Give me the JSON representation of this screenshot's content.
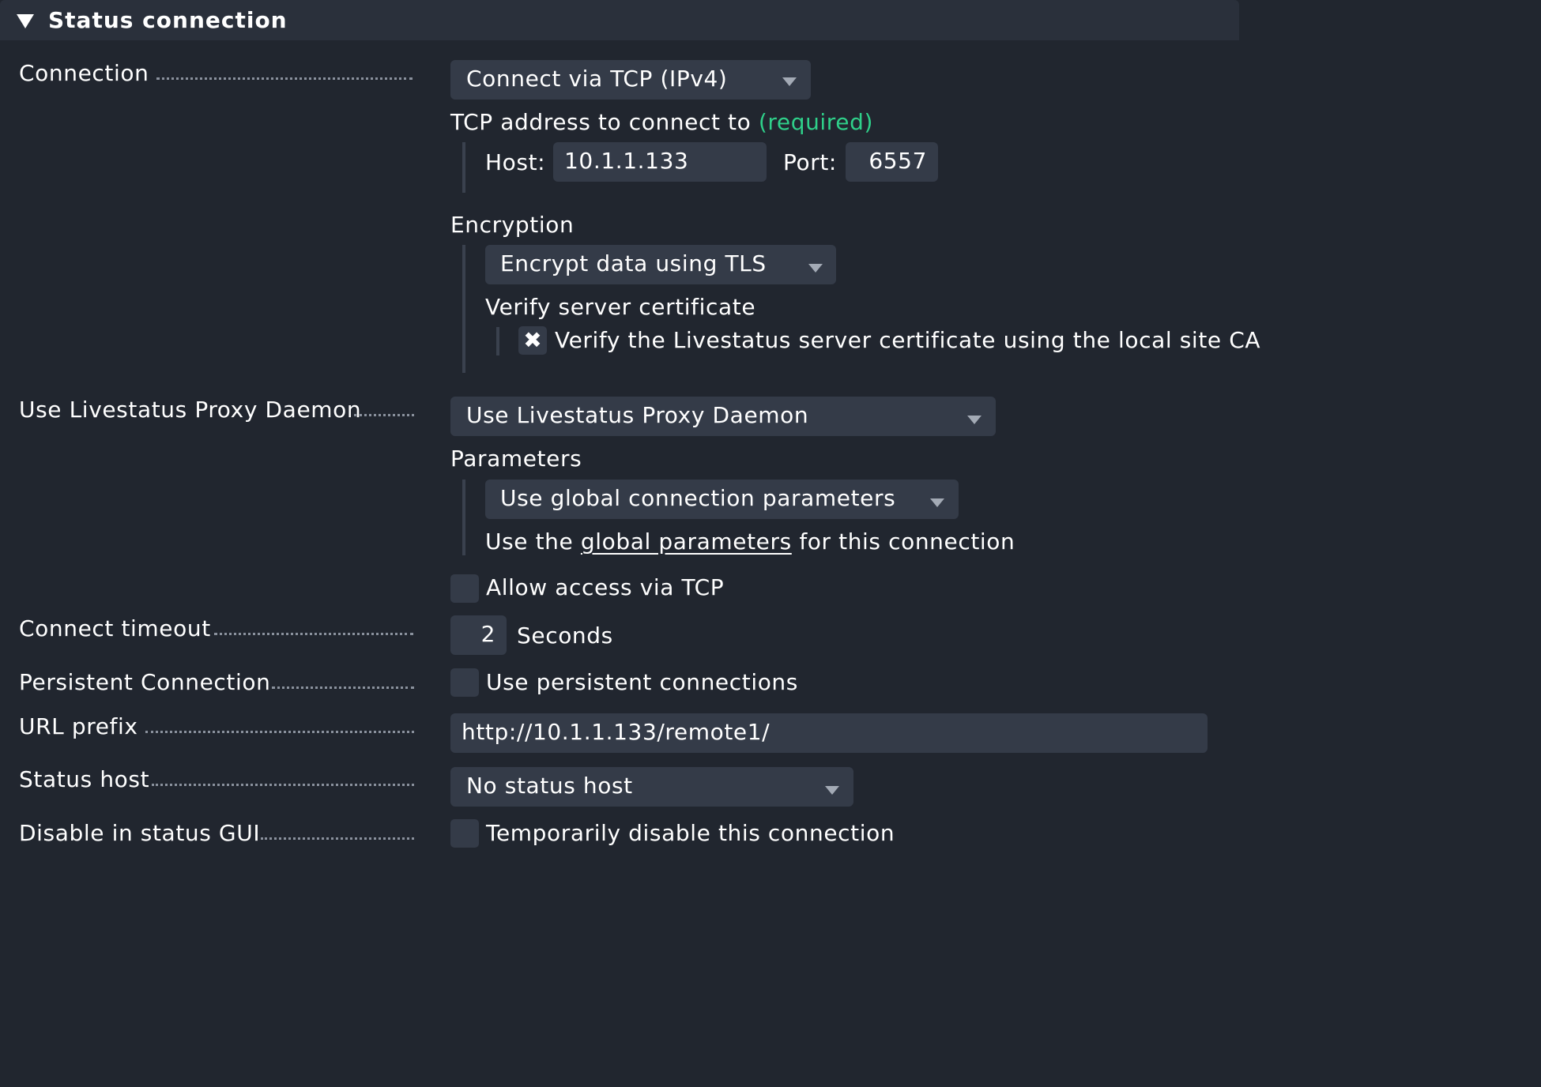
{
  "section": {
    "title": "Status connection"
  },
  "connection": {
    "label": "Connection",
    "select_value": "Connect via TCP (IPv4)",
    "tcp_address_label": "TCP address to connect to",
    "required_text": "(required)",
    "host_label": "Host:",
    "host_value": "10.1.1.133",
    "port_label": "Port:",
    "port_value": "6557",
    "encryption_label": "Encryption",
    "encryption_value": "Encrypt data using TLS",
    "verify_label": "Verify server certificate",
    "verify_checkbox_label": "Verify the Livestatus server certificate using the local site CA",
    "verify_checked": true
  },
  "proxy": {
    "label": "Use Livestatus Proxy Daemon",
    "select_value": "Use Livestatus Proxy Daemon",
    "parameters_label": "Parameters",
    "parameters_value": "Use global connection parameters",
    "help_prefix": "Use the",
    "help_link": "global parameters",
    "help_suffix": "for this connection",
    "allow_tcp_label": "Allow access via TCP",
    "allow_tcp_checked": false
  },
  "timeout": {
    "label": "Connect timeout",
    "value": "2",
    "unit": "Seconds"
  },
  "persistent": {
    "label": "Persistent Connection",
    "checkbox_label": "Use persistent connections",
    "checked": false
  },
  "url_prefix": {
    "label": "URL prefix",
    "value": "http://10.1.1.133/remote1/"
  },
  "status_host": {
    "label": "Status host",
    "select_value": "No status host"
  },
  "disable": {
    "label": "Disable in status GUI",
    "checkbox_label": "Temporarily disable this connection",
    "checked": false
  },
  "icons": {
    "section_toggle": "triangle-down-icon",
    "dropdown": "chevron-down-icon",
    "checkbox_checked": "x-mark-icon"
  }
}
